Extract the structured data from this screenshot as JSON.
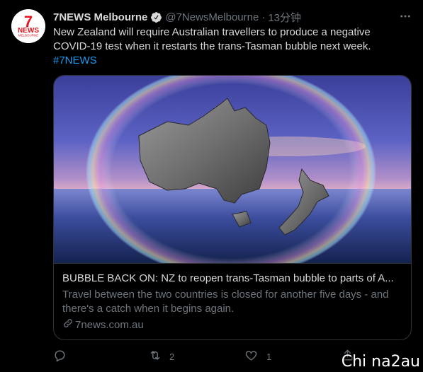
{
  "account": {
    "name": "7NEWS Melbourne",
    "handle": "@7NewsMelbourne",
    "separator": "·",
    "time": "13分钟",
    "avatar_logo_top": "7",
    "avatar_logo_mid": "NEWS",
    "avatar_logo_bottom": "MELBOURNE"
  },
  "tweet": {
    "text": "New Zealand will require Australian travellers to produce a negative COVID-19 test when it restarts the trans-Tasman bubble next week.",
    "hashtag": "#7NEWS"
  },
  "card": {
    "title": "BUBBLE BACK ON: NZ to reopen trans-Tasman bubble to parts of A...",
    "description": "Travel between the two countries is closed for another five days - and there's a catch when it begins again.",
    "domain": "7news.com.au"
  },
  "actions": {
    "reply_count": "",
    "retweet_count": "2",
    "like_count": "1"
  },
  "watermark": "Chi na2au",
  "colors": {
    "background": "#000000",
    "accent": "#1d9bf0",
    "brand_red": "#e4151f",
    "muted": "#6e767d",
    "text": "#d9d9d9"
  },
  "icons": [
    "verified-badge-icon",
    "more-icon",
    "link-icon",
    "reply-icon",
    "retweet-icon",
    "like-icon",
    "share-icon"
  ]
}
